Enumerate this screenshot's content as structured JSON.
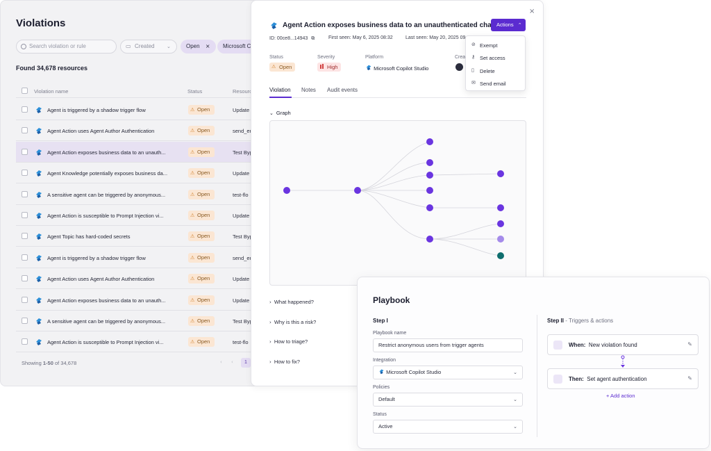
{
  "violations": {
    "title": "Violations",
    "search_placeholder": "Search violation or rule",
    "created_label": "Created",
    "chip_open": "Open",
    "chip_platform": "Microsoft C",
    "found_label": "Found 34,678 resources",
    "columns": {
      "name": "Violation name",
      "status": "Status",
      "resource": "Resourc"
    },
    "rows": [
      {
        "name": "Agent is triggered by a shadow trigger flow",
        "status": "Open",
        "resource": "Update"
      },
      {
        "name": "Agent Action uses Agent Author Authentication",
        "status": "Open",
        "resource": "send_er"
      },
      {
        "name": "Agent Action exposes business data to an unauth...",
        "status": "Open",
        "resource": "Test Byp"
      },
      {
        "name": "Agent Knowledge potentially exposes business da...",
        "status": "Open",
        "resource": "Update"
      },
      {
        "name": "A sensitive agent can be triggered by anonymous...",
        "status": "Open",
        "resource": "test-flo"
      },
      {
        "name": "Agent Action is susceptible to Prompt Injection vi...",
        "status": "Open",
        "resource": "Update"
      },
      {
        "name": "Agent Topic has hard-coded secrets",
        "status": "Open",
        "resource": "Test Byp"
      },
      {
        "name": "Agent is triggered by a shadow trigger flow",
        "status": "Open",
        "resource": "send_er"
      },
      {
        "name": "Agent Action uses Agent Author Authentication",
        "status": "Open",
        "resource": "Update"
      },
      {
        "name": "Agent Action exposes business data to an unauth...",
        "status": "Open",
        "resource": "Update"
      },
      {
        "name": "A sensitive agent can be triggered by anonymous...",
        "status": "Open",
        "resource": "Test Byp"
      },
      {
        "name": "Agent Action is susceptible to Prompt Injection vi...",
        "status": "Open",
        "resource": "test-flo"
      }
    ],
    "showing_prefix": "Showing ",
    "showing_range": "1-50",
    "showing_suffix": " of 34,678",
    "page": "1"
  },
  "detail": {
    "title": "Agent Action exposes business data to an unauthenticated chat",
    "actions_label": "Actions",
    "id_label": "ID: 00ce8...14943",
    "first_seen": "First seen: May 6, 2025 08:32",
    "last_seen": "Last seen: May 20, 2025 09",
    "status_label": "Status",
    "status_value": "Open",
    "severity_label": "Severity",
    "severity_value": "High",
    "platform_label": "Platform",
    "platform_value": "Microsoft Copilot Studio",
    "creator_label": "Crea",
    "tabs": [
      "Violation",
      "Notes",
      "Audit events"
    ],
    "graph_heading": "Graph",
    "accordions": [
      "What happened?",
      "Why is this a risk?",
      "How to triage?",
      "How to fix?"
    ],
    "menu": [
      "Exempt",
      "Set access",
      "Delete",
      "Send email"
    ]
  },
  "playbook": {
    "title": "Playbook",
    "step1": "Step I",
    "name_label": "Playbook name",
    "name_value": "Restrict anonymous users from trigger agents",
    "integration_label": "Integration",
    "integration_value": "Microsoft Copilot Studio",
    "policies_label": "Policies",
    "policies_value": "Default",
    "status_label": "Status",
    "status_value": "Active",
    "step2": "Step II",
    "step2_sub": " - Triggers & actions",
    "when_label": "When:",
    "when_value": "New violation found",
    "then_label": "Then:",
    "then_value": "Set agent authentication",
    "add_action": "+ Add action"
  },
  "colors": {
    "accent": "#5b2bd0",
    "open_badge": "#fbe6d3",
    "high_badge": "#fde4e4"
  }
}
